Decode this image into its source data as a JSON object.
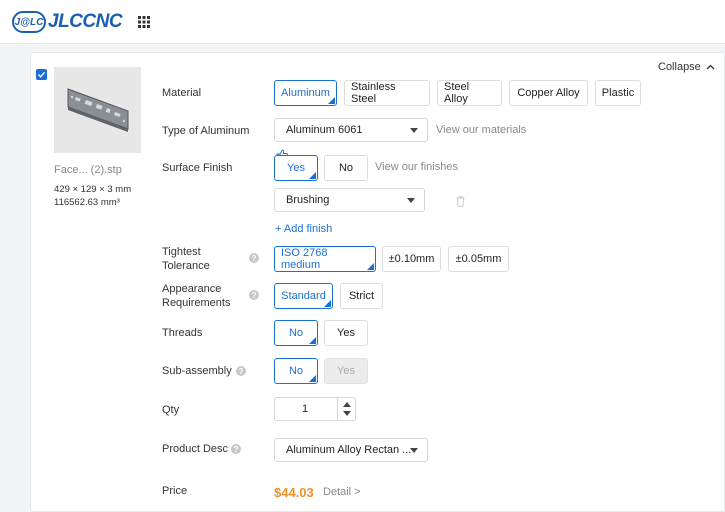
{
  "brand": {
    "badge": "J@LC",
    "name": "JLCCNC"
  },
  "part": {
    "file_name": "Face... (2).stp",
    "dimensions": "429 × 129 × 3 mm",
    "volume": "116562.63 mm³"
  },
  "collapse_label": "Collapse",
  "labels": {
    "material": "Material",
    "type": "Type of Aluminum",
    "surface": "Surface Finish",
    "tolerance_1": "Tightest",
    "tolerance_2": "Tolerance",
    "appearance_1": "Appearance",
    "appearance_2": "Requirements",
    "threads": "Threads",
    "subassembly": "Sub-assembly",
    "qty": "Qty",
    "desc": "Product Desc",
    "price": "Price"
  },
  "material_options": [
    "Aluminum",
    "Stainless Steel",
    "Steel Alloy",
    "Copper Alloy",
    "Plastic"
  ],
  "aluminum_type": {
    "value": "Aluminum 6061",
    "link": "View our materials"
  },
  "surface_finish": {
    "yes": "Yes",
    "no": "No",
    "link": "View our finishes",
    "finish_value": "Brushing",
    "add": "+ Add finish"
  },
  "tolerance_options": [
    "ISO 2768 medium",
    "±0.10mm",
    "±0.05mm"
  ],
  "appearance_options": [
    "Standard",
    "Strict"
  ],
  "threads": {
    "no": "No",
    "yes": "Yes"
  },
  "subassembly": {
    "no": "No",
    "yes": "Yes"
  },
  "qty_value": "1",
  "product_desc": "Aluminum Alloy Rectan ...",
  "price": {
    "value": "$44.03",
    "detail": "Detail >"
  },
  "colors": {
    "brand": "#1a5fb4",
    "accent": "#1a6fd6",
    "price": "#f0902a"
  }
}
